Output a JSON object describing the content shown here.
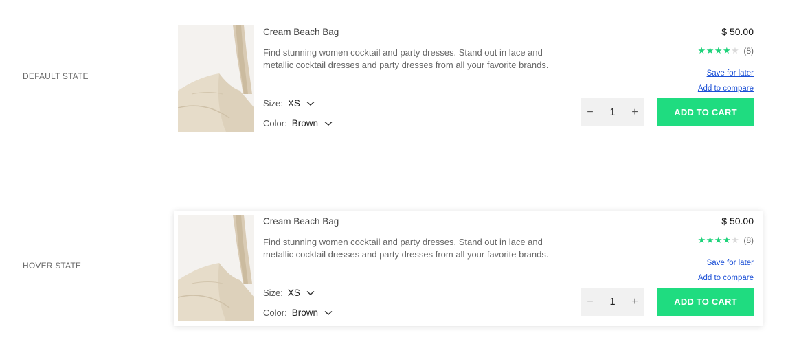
{
  "states": [
    {
      "label": "DEFAULT STATE",
      "product": {
        "name": "Cream Beach Bag",
        "description": "Find stunning women cocktail and party dresses. Stand out in lace and metallic cocktail dresses and party dresses from all your favorite brands.",
        "size_label": "Size:",
        "size_value": "XS",
        "color_label": "Color:",
        "color_value": "Brown",
        "price": "$ 50.00",
        "rating": 4,
        "rating_max": 5,
        "review_count": "(8)",
        "save_link": "Save for later",
        "compare_link": "Add to compare",
        "qty_minus": "−",
        "qty_value": "1",
        "qty_plus": "+",
        "cart_label": "ADD TO CART"
      }
    },
    {
      "label": "HOVER STATE",
      "product": {
        "name": "Cream Beach Bag",
        "description": "Find stunning women cocktail and party dresses. Stand out in lace and metallic cocktail dresses and party dresses from all your favorite brands.",
        "size_label": "Size:",
        "size_value": "XS",
        "color_label": "Color:",
        "color_value": "Brown",
        "price": "$ 50.00",
        "rating": 4,
        "rating_max": 5,
        "review_count": "(8)",
        "save_link": "Save for later",
        "compare_link": "Add to compare",
        "qty_minus": "−",
        "qty_value": "1",
        "qty_plus": "+",
        "cart_label": "ADD TO CART"
      }
    }
  ],
  "colors": {
    "accent": "#1fdc80",
    "star_on": "#1ed27a",
    "star_off": "#d9d9d9",
    "link": "#1a4fd6"
  },
  "icons": {
    "size_dropdown": "chevron-down-icon",
    "color_dropdown": "chevron-down-icon",
    "product_image": "cream-tote-bag-image"
  }
}
